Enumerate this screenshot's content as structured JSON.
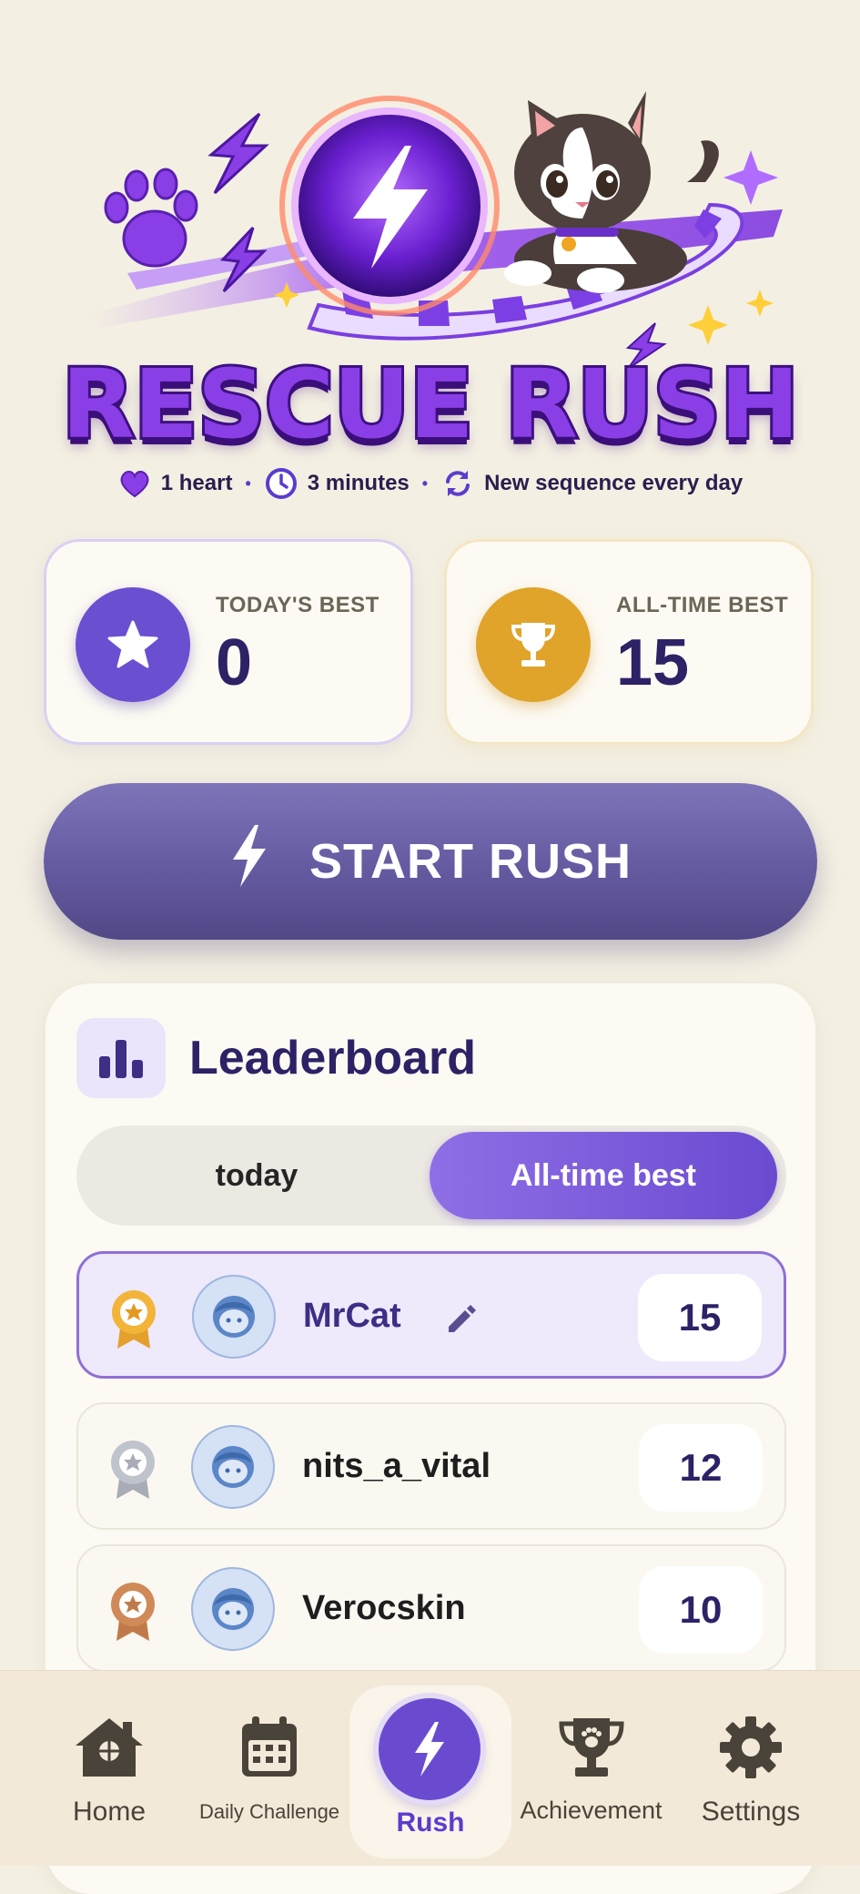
{
  "hero": {
    "title": "RESCUE RUSH",
    "meta": [
      {
        "icon": "heart-icon",
        "text": "1 heart"
      },
      {
        "icon": "clock-icon",
        "text": "3 minutes"
      },
      {
        "icon": "refresh-icon",
        "text": "New sequence every day"
      }
    ],
    "separator": "•"
  },
  "stats": {
    "today_label": "TODAY'S BEST",
    "today_value": "0",
    "alltime_label": "ALL-TIME BEST",
    "alltime_value": "15"
  },
  "start_button": {
    "label": "START RUSH",
    "icon": "lightning-icon"
  },
  "leaderboard": {
    "title": "Leaderboard",
    "tabs": [
      {
        "label": "today",
        "selected": false
      },
      {
        "label": "All-time best",
        "selected": true
      }
    ],
    "rows": [
      {
        "name": "MrCat",
        "score": "15",
        "medal": "gold",
        "current_user": true
      },
      {
        "name": "nits_a_vital",
        "score": "12",
        "medal": "silver",
        "current_user": false
      },
      {
        "name": "Verocskin",
        "score": "10",
        "medal": "bronze",
        "current_user": false
      }
    ]
  },
  "nav": {
    "items": [
      {
        "label": "Home",
        "icon": "home-icon"
      },
      {
        "label": "Daily Challenge",
        "icon": "calendar-icon"
      },
      {
        "label": "Rush",
        "icon": "lightning-icon",
        "active": true
      },
      {
        "label": "Achievement",
        "icon": "trophy-icon"
      },
      {
        "label": "Settings",
        "icon": "gear-icon"
      }
    ]
  },
  "colors": {
    "background": "#f3efe2",
    "primary_purple": "#6a4bd0",
    "gold": "#e0a42b",
    "dark_text": "#2d2266"
  }
}
